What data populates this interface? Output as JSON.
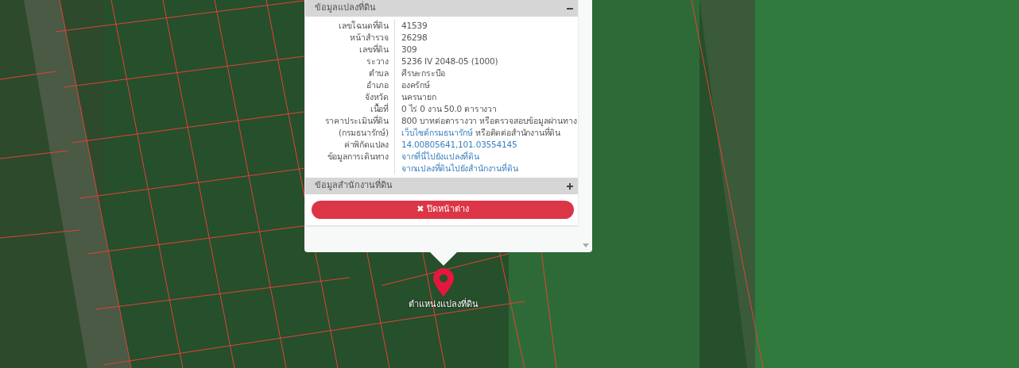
{
  "map": {
    "marker_label": "ตำแหน่งแปลงที่ดิน"
  },
  "popup": {
    "sections": [
      {
        "title": "ข้อมูลแปลงที่ดิน",
        "expanded": true,
        "rows": [
          {
            "label": "เลขโฉนดที่ดิน",
            "lines": [
              [
                {
                  "kind": "text",
                  "text": "41539"
                }
              ]
            ]
          },
          {
            "label": "หน้าสำรวจ",
            "lines": [
              [
                {
                  "kind": "text",
                  "text": "26298"
                }
              ]
            ]
          },
          {
            "label": "เลขที่ดิน",
            "lines": [
              [
                {
                  "kind": "text",
                  "text": "309"
                }
              ]
            ]
          },
          {
            "label": "ระวาง",
            "lines": [
              [
                {
                  "kind": "text",
                  "text": "5236 IV 2048-05 (1000)"
                }
              ]
            ]
          },
          {
            "label": "ตำบล",
            "lines": [
              [
                {
                  "kind": "text",
                  "text": "ศีรษะกระบือ"
                }
              ]
            ]
          },
          {
            "label": "อำเภอ",
            "lines": [
              [
                {
                  "kind": "text",
                  "text": "องครักษ์"
                }
              ]
            ]
          },
          {
            "label": "จังหวัด",
            "lines": [
              [
                {
                  "kind": "text",
                  "text": "นครนายก"
                }
              ]
            ]
          },
          {
            "label": "เนื้อที่",
            "lines": [
              [
                {
                  "kind": "text",
                  "text": "0 ไร่ 0 งาน 50.0 ตารางวา"
                }
              ]
            ]
          },
          {
            "label": "ราคาประเมินที่ดิน",
            "lines": [
              [
                {
                  "kind": "text",
                  "text": "800 บาทต่อตารางวา หรือตรวจสอบข้อมูลผ่านทาง"
                }
              ]
            ]
          },
          {
            "label": "(กรมธนารักษ์)",
            "lines": [
              [
                {
                  "kind": "link",
                  "text": "เว็บไซต์กรมธนารักษ์"
                },
                {
                  "kind": "text",
                  "text": "หรือติดต่อสำนักงานที่ดิน"
                }
              ]
            ]
          },
          {
            "label": "ค่าพิกัดแปลง",
            "lines": [
              [
                {
                  "kind": "link",
                  "text": "14.00805641,101.03554145"
                }
              ]
            ]
          },
          {
            "label": "ข้อมูลการเดินทาง",
            "lines": [
              [
                {
                  "kind": "link",
                  "text": "จากที่นี่ไปยังแปลงที่ดิน"
                }
              ],
              [
                {
                  "kind": "link",
                  "text": "จากแปลงที่ดินไปยังสำนักงานที่ดิน"
                }
              ]
            ]
          }
        ]
      },
      {
        "title": "ข้อมูลสำนักงานที่ดิน",
        "expanded": false
      }
    ],
    "close_button": {
      "icon": "✖",
      "label": "ปิดหน้าต่าง"
    }
  }
}
